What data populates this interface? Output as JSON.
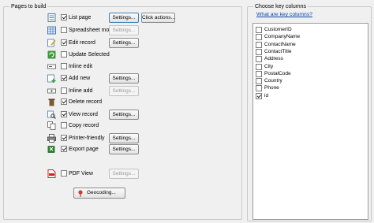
{
  "left_panel": {
    "title": "Pages to build",
    "pages": [
      {
        "label": "List page",
        "checked": true,
        "icon": "list-page-icon",
        "settings": "Settings...",
        "settings_enabled": true,
        "extra": "Click actions..."
      },
      {
        "label": "Spreadsheet mode",
        "checked": false,
        "icon": "spreadsheet-icon",
        "settings": "Settings...",
        "settings_enabled": false
      },
      {
        "label": "Edit record",
        "checked": true,
        "icon": "edit-record-icon",
        "settings": "Settings...",
        "settings_enabled": true
      },
      {
        "label": "Update Selected",
        "checked": false,
        "icon": "update-selected-icon"
      },
      {
        "label": "Inline edit",
        "checked": false,
        "icon": "inline-edit-icon"
      },
      {
        "label": "Add new",
        "checked": true,
        "icon": "add-new-icon",
        "settings": "Settings...",
        "settings_enabled": true
      },
      {
        "label": "Inline add",
        "checked": false,
        "icon": "inline-add-icon",
        "settings": "Settings...",
        "settings_enabled": false
      },
      {
        "label": "Delete record",
        "checked": true,
        "icon": "delete-icon"
      },
      {
        "label": "View record",
        "checked": true,
        "icon": "view-record-icon",
        "settings": "Settings...",
        "settings_enabled": true
      },
      {
        "label": "Copy record",
        "checked": false,
        "icon": "copy-record-icon"
      },
      {
        "label": "Printer-friendly",
        "checked": true,
        "icon": "printer-icon",
        "settings": "Settings...",
        "settings_enabled": true
      },
      {
        "label": "Export page",
        "checked": true,
        "icon": "export-icon",
        "settings": "Settings...",
        "settings_enabled": true
      },
      {
        "label": "PDF View",
        "checked": false,
        "icon": "pdf-icon",
        "settings": "Settings...",
        "settings_enabled": false
      }
    ],
    "geocoding": {
      "label": "Geocoding...",
      "icon": "map-pin-icon"
    }
  },
  "right_panel": {
    "title": "Choose key columns",
    "link": "What are key columns?",
    "columns": [
      {
        "label": "CustomerID",
        "checked": false
      },
      {
        "label": "CompanyName",
        "checked": false
      },
      {
        "label": "ContactName",
        "checked": false
      },
      {
        "label": "ContactTitle",
        "checked": false
      },
      {
        "label": "Address",
        "checked": false
      },
      {
        "label": "City",
        "checked": false
      },
      {
        "label": "PostalCode",
        "checked": false
      },
      {
        "label": "Country",
        "checked": false
      },
      {
        "label": "Phone",
        "checked": false
      },
      {
        "label": "id",
        "checked": true
      }
    ]
  },
  "colors": {
    "link": "#0645ad",
    "active_border": "#3c7fb1",
    "background": "#f0f0f0"
  }
}
